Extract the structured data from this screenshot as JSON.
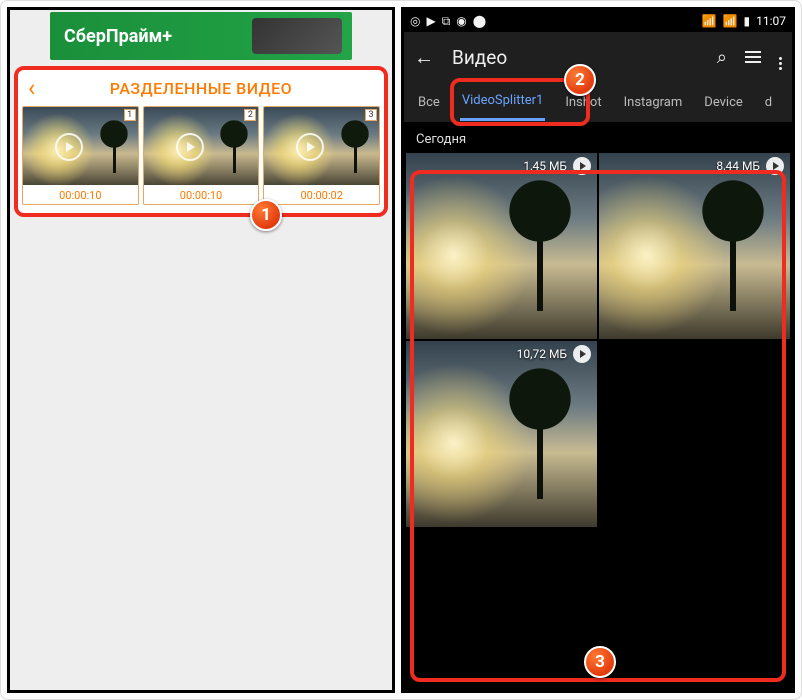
{
  "left": {
    "ad_text": "СберПрайм+",
    "header_title": "РАЗДЕЛЕННЫЕ ВИДЕО",
    "thumbs": [
      {
        "index": "1",
        "time": "00:00:10"
      },
      {
        "index": "2",
        "time": "00:00:10"
      },
      {
        "index": "3",
        "time": "00:00:02"
      }
    ]
  },
  "right": {
    "statusbar": {
      "left_icons": [
        "◎",
        "▶",
        "⧉",
        "◉",
        "⬤"
      ],
      "wifi": "▾",
      "signal": "▮",
      "battery": "▮",
      "time": "11:07"
    },
    "appbar": {
      "back": "←",
      "title": "Видео",
      "search": "⌕",
      "view_toggle": "list",
      "menu": "⋮"
    },
    "tabs": [
      "Все",
      "VideoSplitter1",
      "Inshot",
      "Instagram",
      "Device",
      "d"
    ],
    "active_tab_index": 1,
    "section_label": "Сегодня",
    "videos": [
      {
        "size": "1,45 МБ"
      },
      {
        "size": "8,44 МБ"
      },
      {
        "size": "10,72 МБ"
      }
    ]
  },
  "callouts": {
    "one": "1",
    "two": "2",
    "three": "3"
  }
}
